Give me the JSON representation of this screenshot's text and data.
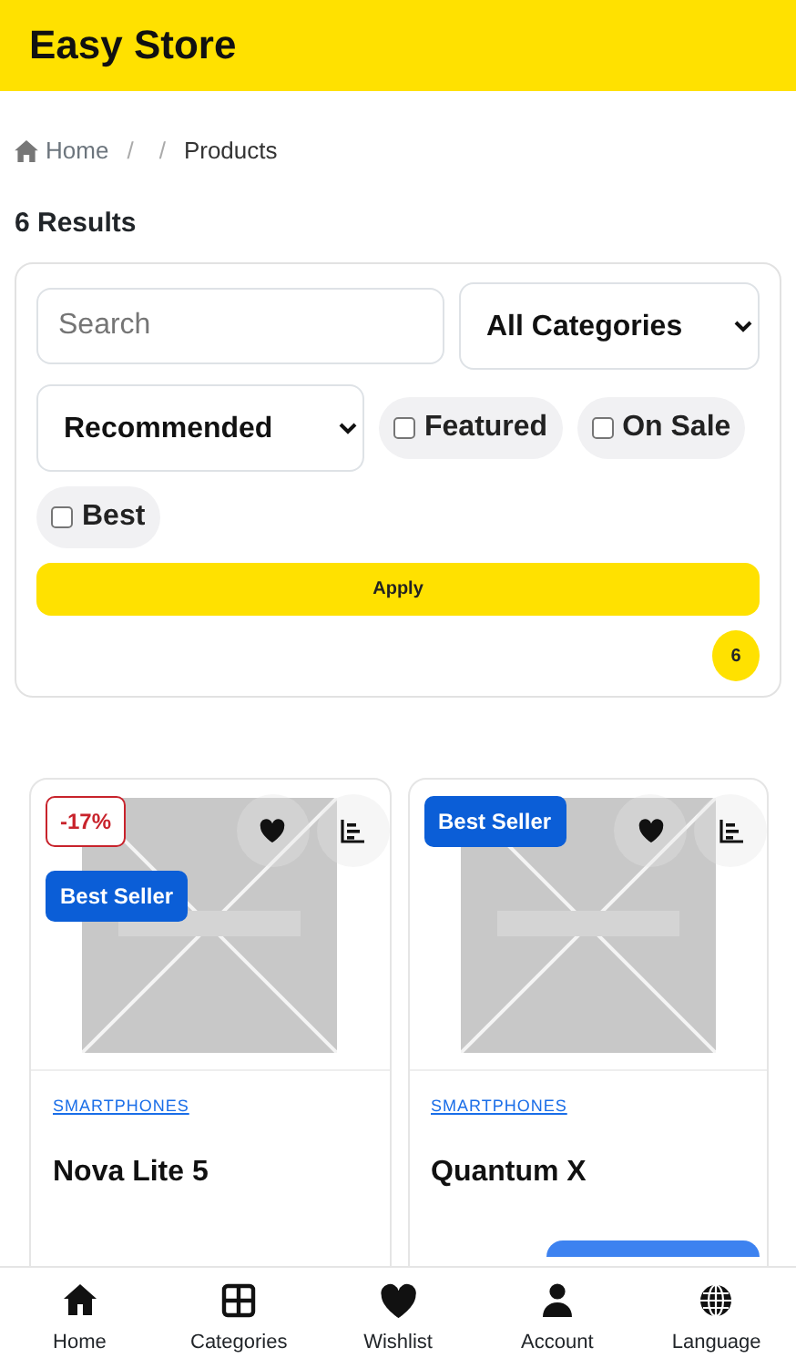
{
  "header": {
    "title": "Easy Store"
  },
  "breadcrumb": [
    {
      "label": "Home",
      "kind": "home"
    },
    {
      "label": "/",
      "kind": "sep"
    },
    {
      "label": "/",
      "kind": "sep"
    },
    {
      "label": "Products",
      "kind": "current"
    }
  ],
  "results_title": "6 Results",
  "filters": {
    "search": {
      "placeholder": "Search"
    },
    "category": {
      "value": "All Categories"
    },
    "sort": {
      "value": "Recommended"
    },
    "checkboxes": [
      {
        "label": "Featured",
        "checked": false
      },
      {
        "label": "On Sale",
        "checked": false
      },
      {
        "label": "Best",
        "checked": false
      }
    ],
    "apply": "Apply",
    "count": "6"
  },
  "products": [
    {
      "discount": "-17%",
      "badge": "Best Seller",
      "category": "SMARTPHONES",
      "name": "Nova Lite 5",
      "kind": "picture"
    },
    {
      "badge": "Best Seller",
      "category": "SMARTPHONES",
      "name": "Quantum X",
      "kind": "picture"
    }
  ],
  "bottom_nav": [
    {
      "label": "Home",
      "kind": "home"
    },
    {
      "label": "Categories",
      "kind": "grid"
    },
    {
      "label": "Wishlist",
      "kind": "heart"
    },
    {
      "label": "Account",
      "kind": "person"
    },
    {
      "label": "Language",
      "kind": "globe"
    }
  ]
}
